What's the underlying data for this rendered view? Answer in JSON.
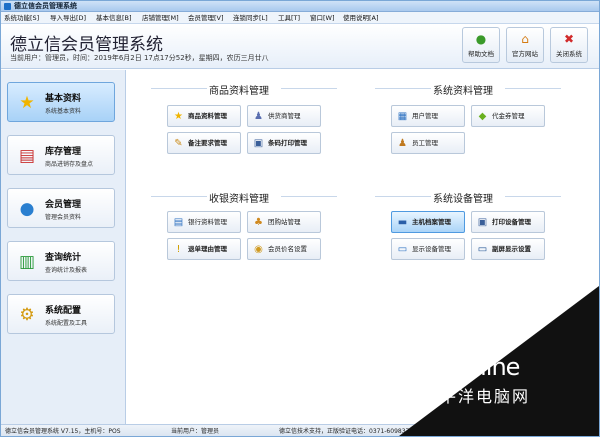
{
  "window": {
    "title": "德立信会员管理系统"
  },
  "menu": [
    "系统功能[S]",
    "导入导出[D]",
    "基本信息[B]",
    "店铺管理[M]",
    "会员管理[V]",
    "连锁同步[L]",
    "工具[T]",
    "窗口[W]",
    "使用说明[A]"
  ],
  "header": {
    "title": "德立信会员管理系统",
    "info": "当前用户：管理员，时间：2019年6月2日 17点17分52秒，星期四，农历三月廿八",
    "buttons": [
      {
        "label": "帮助文档",
        "icon": "help-icon"
      },
      {
        "label": "官方网站",
        "icon": "home-icon"
      },
      {
        "label": "关闭系统",
        "icon": "close-icon"
      }
    ]
  },
  "sidebar": [
    {
      "title": "基本资料",
      "sub": "系统基本资料",
      "icon": "star-icon"
    },
    {
      "title": "库存管理",
      "sub": "商品进销存及盘点",
      "icon": "cart-icon"
    },
    {
      "title": "会员管理",
      "sub": "管理会员资料",
      "icon": "members-icon"
    },
    {
      "title": "查询统计",
      "sub": "查询统计及报表",
      "icon": "chart-icon"
    },
    {
      "title": "系统配置",
      "sub": "系统配置及工具",
      "icon": "config-icon"
    }
  ],
  "sections": {
    "goods": {
      "title": "商品资料管理",
      "buttons": [
        {
          "label": "商品资料管理",
          "icon": "star-icon"
        },
        {
          "label": "供货商管理",
          "icon": "supplier-icon"
        },
        {
          "label": "备注要求管理",
          "icon": "pencil-icon"
        },
        {
          "label": "条码打印管理",
          "icon": "printer-icon"
        }
      ]
    },
    "system": {
      "title": "系统资料管理",
      "buttons": [
        {
          "label": "用户管理",
          "icon": "user-icon"
        },
        {
          "label": "代金券管理",
          "icon": "coupon-icon"
        },
        {
          "label": "员工管理",
          "icon": "staff-icon"
        }
      ]
    },
    "cashier": {
      "title": "收银资料管理",
      "buttons": [
        {
          "label": "银行资料管理",
          "icon": "bank-icon"
        },
        {
          "label": "团购站管理",
          "icon": "group-icon"
        },
        {
          "label": "退单理由管理",
          "icon": "warning-icon"
        },
        {
          "label": "会员价名设置",
          "icon": "price-icon"
        }
      ]
    },
    "devices": {
      "title": "系统设备管理",
      "buttons": [
        {
          "label": "主机档案管理",
          "icon": "host-icon"
        },
        {
          "label": "打印设备管理",
          "icon": "printer-icon"
        },
        {
          "label": "显示设备管理",
          "icon": "display-icon"
        },
        {
          "label": "副屏显示设置",
          "icon": "second-screen-icon"
        }
      ]
    }
  },
  "status": {
    "version": "德立信会员管理系统 V7.15，主机号：POS",
    "user": "当前用户：管理员",
    "support": "德立信技术支持，正版验证电话：0371-60983722"
  },
  "watermark": {
    "brand": "PConline",
    "sub": "太平洋电脑网"
  }
}
